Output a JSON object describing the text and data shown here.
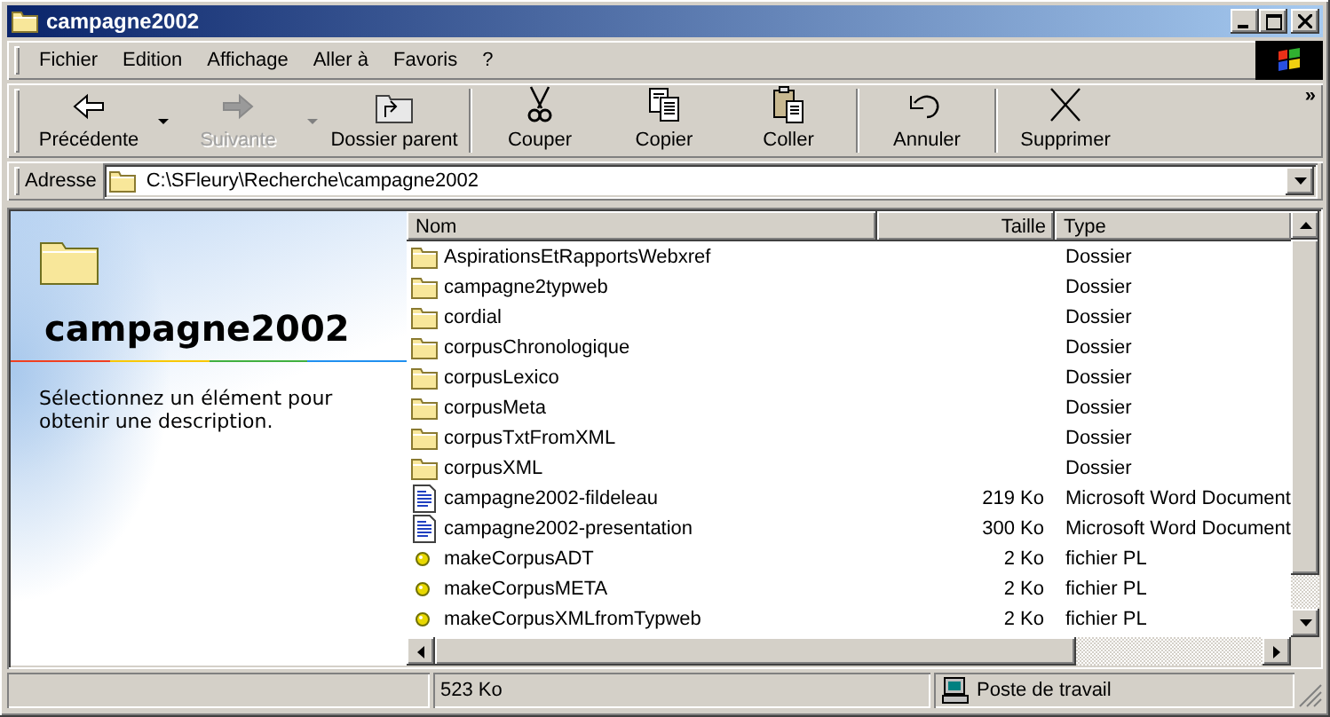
{
  "window": {
    "title": "campagne2002"
  },
  "menu": [
    {
      "label": "Fichier"
    },
    {
      "label": "Edition"
    },
    {
      "label": "Affichage"
    },
    {
      "label": "Aller à"
    },
    {
      "label": "Favoris"
    },
    {
      "label": "?"
    }
  ],
  "toolbar": {
    "groups": [
      [
        {
          "kind": "back",
          "label": "Précédente",
          "disabled": false,
          "dropdown": true
        },
        {
          "kind": "forward",
          "label": "Suivante",
          "disabled": true,
          "dropdown": true
        },
        {
          "kind": "up",
          "label": "Dossier parent",
          "disabled": false,
          "dropdown": false
        }
      ],
      [
        {
          "kind": "cut",
          "label": "Couper",
          "disabled": false,
          "dropdown": false
        },
        {
          "kind": "copy",
          "label": "Copier",
          "disabled": false,
          "dropdown": false
        },
        {
          "kind": "paste",
          "label": "Coller",
          "disabled": false,
          "dropdown": false
        }
      ],
      [
        {
          "kind": "undo",
          "label": "Annuler",
          "disabled": false,
          "dropdown": false
        }
      ],
      [
        {
          "kind": "delete",
          "label": "Supprimer",
          "disabled": false,
          "dropdown": false
        }
      ]
    ],
    "overflow": "»"
  },
  "address": {
    "label": "Adresse",
    "value": "C:\\SFleury\\Recherche\\campagne2002"
  },
  "web_pane": {
    "title": "campagne2002",
    "description": "Sélectionnez un élément pour obtenir une description."
  },
  "file_list": {
    "columns": [
      "Nom",
      "Taille",
      "Type"
    ],
    "rows": [
      {
        "kind": "folder",
        "name": "AspirationsEtRapportsWebxref",
        "size": "",
        "type": "Dossier"
      },
      {
        "kind": "folder",
        "name": "campagne2typweb",
        "size": "",
        "type": "Dossier"
      },
      {
        "kind": "folder",
        "name": "cordial",
        "size": "",
        "type": "Dossier"
      },
      {
        "kind": "folder",
        "name": "corpusChronologique",
        "size": "",
        "type": "Dossier"
      },
      {
        "kind": "folder",
        "name": "corpusLexico",
        "size": "",
        "type": "Dossier"
      },
      {
        "kind": "folder",
        "name": "corpusMeta",
        "size": "",
        "type": "Dossier"
      },
      {
        "kind": "folder",
        "name": "corpusTxtFromXML",
        "size": "",
        "type": "Dossier"
      },
      {
        "kind": "folder",
        "name": "corpusXML",
        "size": "",
        "type": "Dossier"
      },
      {
        "kind": "document",
        "name": "campagne2002-fildeleau",
        "size": "219 Ko",
        "type": "Microsoft Word Document"
      },
      {
        "kind": "document",
        "name": "campagne2002-presentation",
        "size": "300 Ko",
        "type": "Microsoft Word Document"
      },
      {
        "kind": "script",
        "name": "makeCorpusADT",
        "size": "2 Ko",
        "type": "fichier PL"
      },
      {
        "kind": "script",
        "name": "makeCorpusMETA",
        "size": "2 Ko",
        "type": "fichier PL"
      },
      {
        "kind": "script",
        "name": "makeCorpusXMLfromTypweb",
        "size": "2 Ko",
        "type": "fichier PL"
      }
    ]
  },
  "status_bar": {
    "size": "523 Ko",
    "zone": "Poste de travail"
  }
}
